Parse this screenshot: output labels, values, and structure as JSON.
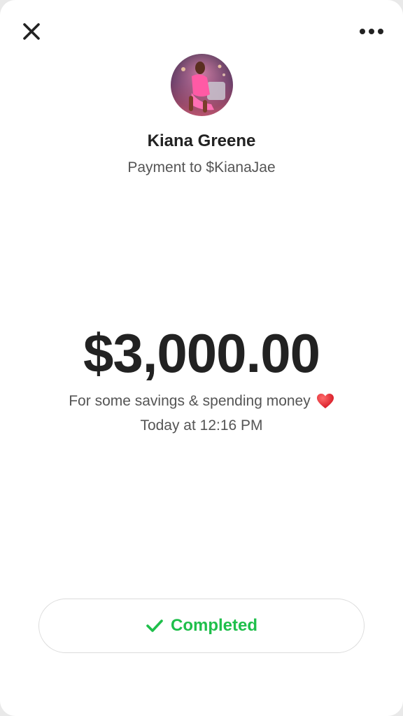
{
  "recipient": {
    "name": "Kiana Greene",
    "subtitle": "Payment to $KianaJae"
  },
  "payment": {
    "amount": "$3,000.00",
    "note": "For some savings & spending money",
    "note_emoji": "red-heart",
    "timestamp": "Today at 12:16 PM"
  },
  "status": {
    "label": "Completed",
    "icon": "checkmark-icon",
    "color": "#1fbf4b"
  },
  "icons": {
    "close": "close-icon",
    "more": "more-options-icon"
  }
}
